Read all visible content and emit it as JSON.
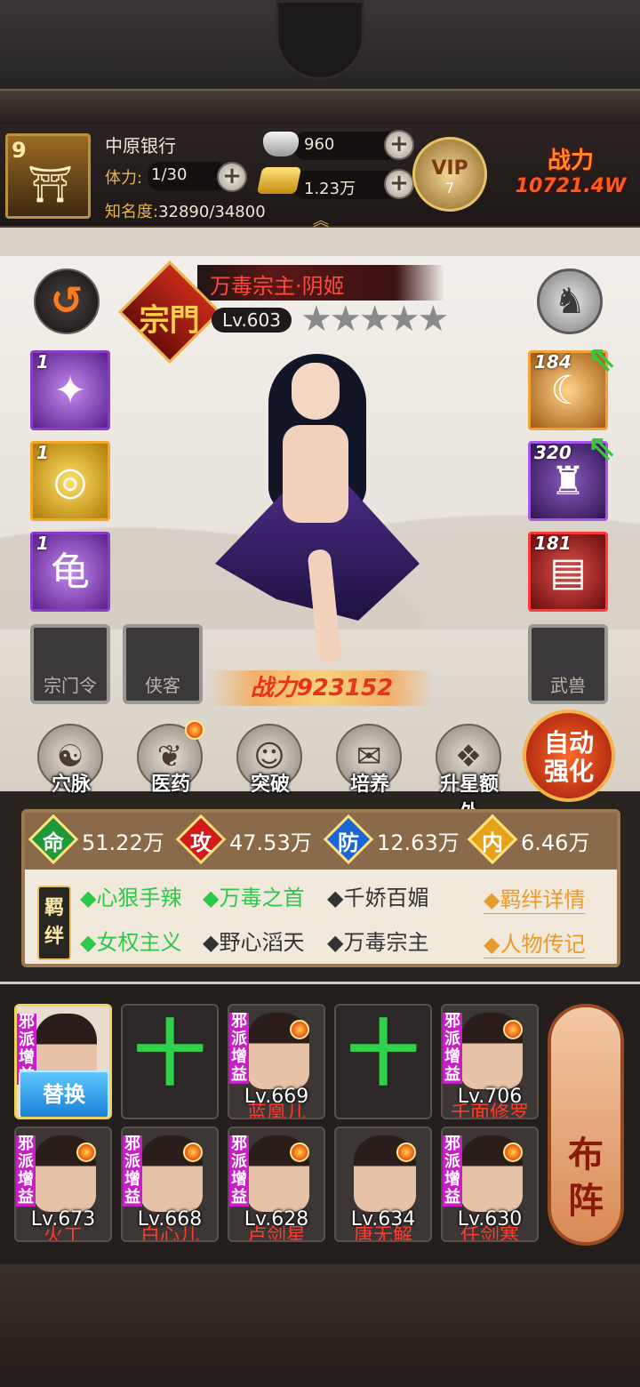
{
  "header": {
    "player_level": "9",
    "player_name": "中原银行",
    "stamina_label": "体力:",
    "stamina_value": "1/30",
    "fame_label": "知名度:",
    "fame_value": "32890/34800",
    "silver": "960",
    "gold": "1.23万",
    "vip_label": "VIP",
    "vip_level": "7",
    "power_label": "战力",
    "power_value": "10721.4W"
  },
  "hero": {
    "title": "万毒宗主·阴姬",
    "sect_badge": "宗門",
    "level": "Lv.603",
    "stars": "★★★★★",
    "star_count": 5,
    "power": "战力923152"
  },
  "skills": [
    {
      "count": "1",
      "glyph": "✦"
    },
    {
      "count": "1",
      "glyph": "◎"
    },
    {
      "count": "1",
      "glyph": "龟"
    }
  ],
  "equipment": [
    {
      "count": "184",
      "glyph": "☾"
    },
    {
      "count": "320",
      "glyph": "♜"
    },
    {
      "count": "181",
      "glyph": "▤"
    }
  ],
  "locked_slots": {
    "sect_token": "宗门令",
    "retainer": "侠客",
    "beast": "武兽"
  },
  "functions": {
    "acupoints": "穴脉",
    "medicine": "医药",
    "breakthrough": "突破",
    "cultivate": "培养",
    "star_up": "升星额外",
    "auto_enhance": "自动强化"
  },
  "stats": {
    "hp_char": "命",
    "hp": "51.22万",
    "atk_char": "攻",
    "atk": "47.53万",
    "def_char": "防",
    "def": "12.63万",
    "inner_char": "内",
    "inner": "6.46万"
  },
  "bonds": {
    "tag": "羁绊",
    "items": [
      {
        "label": "◆心狠手辣"
      },
      {
        "label": "◆万毒之首"
      },
      {
        "label": "◆千娇百媚"
      },
      {
        "label": "◆女权主义"
      },
      {
        "label": "◆野心滔天"
      },
      {
        "label": "◆万毒宗主"
      }
    ],
    "detail_link": "◆羁绊详情",
    "bio_link": "◆人物传记"
  },
  "team": {
    "evil_tag": "邪派增益",
    "replace_label": "替换",
    "add_symbol": "十",
    "members": [
      {
        "lv": "",
        "name": ""
      },
      {
        "lv": "Lv.669",
        "name": "蓝凰儿"
      },
      {
        "lv": "Lv.706",
        "name": "千面修罗"
      },
      {
        "lv": "Lv.673",
        "name": "火工"
      },
      {
        "lv": "Lv.668",
        "name": "白心儿"
      },
      {
        "lv": "Lv.628",
        "name": "卢剑星"
      },
      {
        "lv": "Lv.634",
        "name": "唐无解"
      },
      {
        "lv": "Lv.630",
        "name": "任剑寒"
      }
    ],
    "formation_label_1": "布",
    "formation_label_2": "阵"
  },
  "colors": {
    "accent_red": "#e8321a",
    "bond_active": "#2cc84a",
    "link_orange": "#e99a2e"
  }
}
